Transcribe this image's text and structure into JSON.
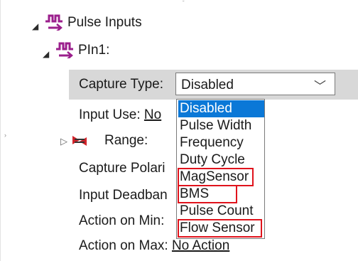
{
  "tree": {
    "root_label": "Pulse Inputs",
    "child_label": "PIn1:",
    "rows": {
      "capture_type_label": "Capture Type:",
      "input_use_label": "Input Use:",
      "input_use_value": "No",
      "range_label": "Range:",
      "capture_polarity_label": "Capture Polari",
      "input_deadband_label": "Input Deadban",
      "action_min_label": "Action on Min:",
      "action_max_label": "Action on Max:",
      "action_max_value": "No Action"
    }
  },
  "combo": {
    "selected": "Disabled",
    "options": [
      "Disabled",
      "Pulse Width",
      "Frequency",
      "Duty Cycle",
      "MagSensor",
      "BMS",
      "Pulse Count",
      "Flow Sensor"
    ],
    "highlighted_option": "Disabled",
    "red_boxed_options": [
      "MagSensor",
      "BMS",
      "Flow Sensor"
    ]
  },
  "icons": {
    "pulse_inputs": "pulse-waveform-icon",
    "pin": "pulse-waveform-icon",
    "range": "range-arrows-icon",
    "expand_open": "expander-open-icon",
    "expand_closed": "expander-closed-icon",
    "dropdown": "chevron-down-icon"
  },
  "colors": {
    "selection_blue": "#0b78d7",
    "annotation_red": "#e0131c",
    "icon_magenta": "#9b1f8c",
    "row_highlight": "#d8d8d8"
  }
}
